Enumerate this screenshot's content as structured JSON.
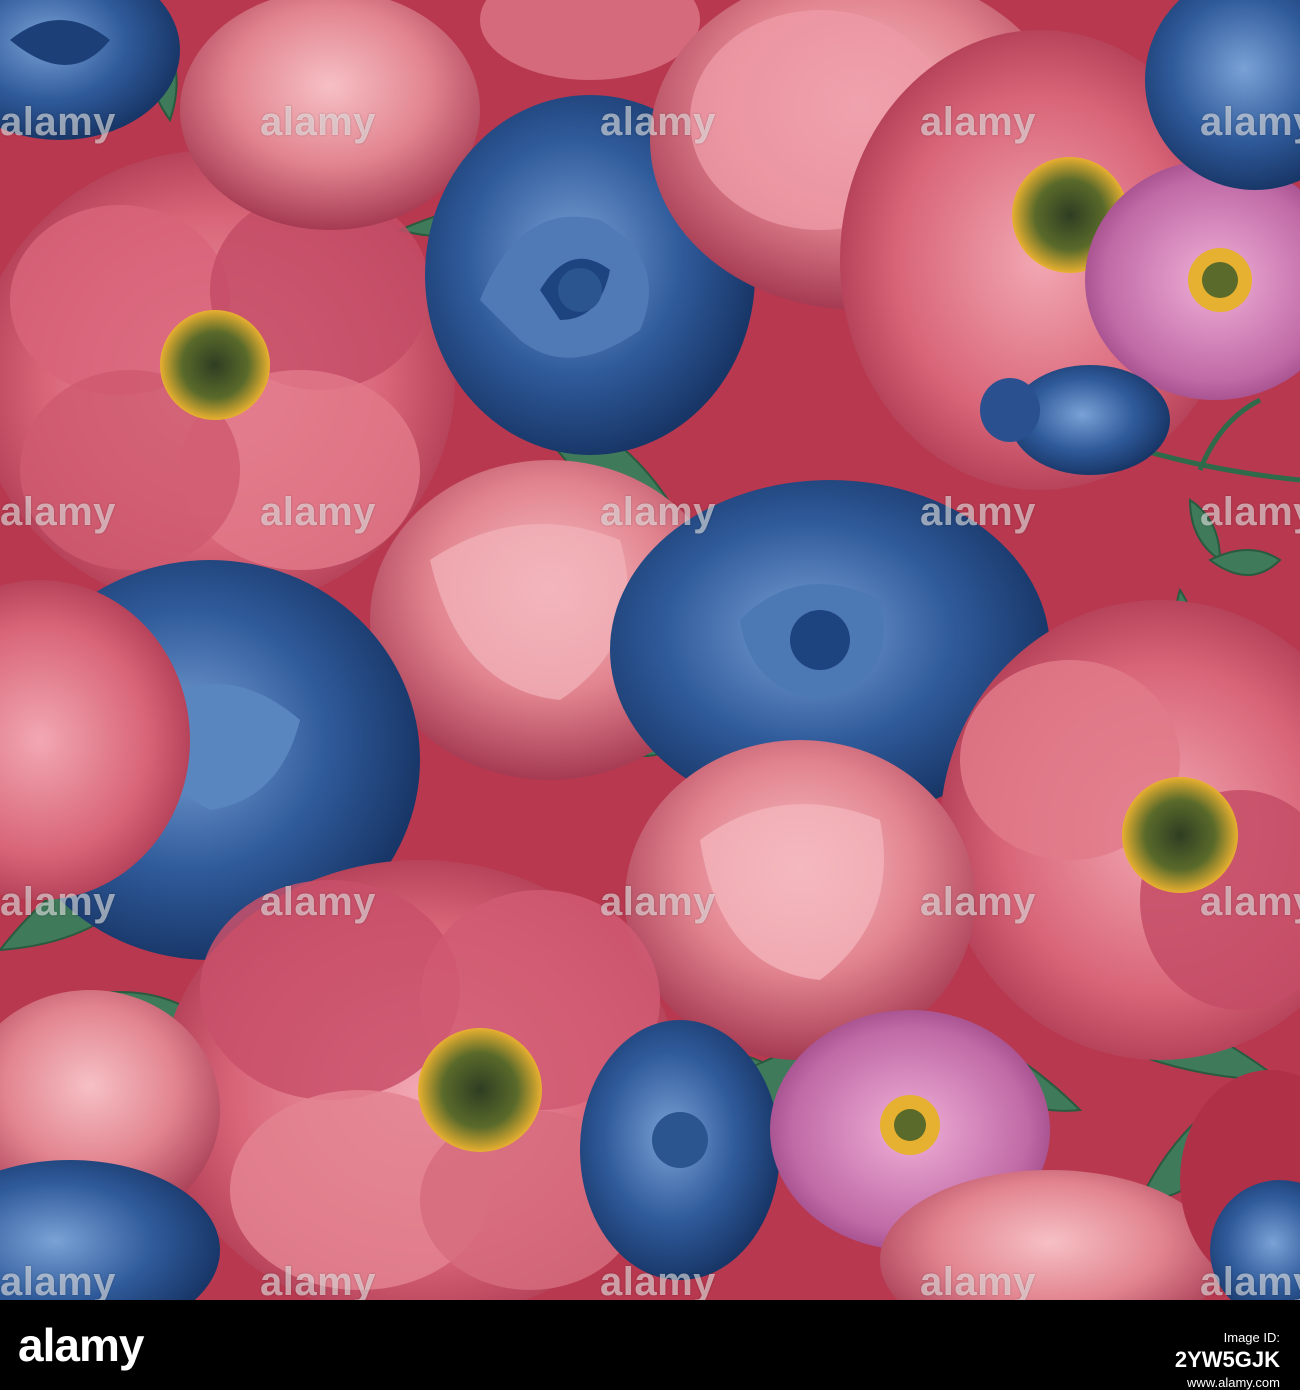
{
  "image": {
    "alt": "Seamless watercolor floral pattern of pink peonies, pink wild roses and blue roses",
    "colors": {
      "background": "#b8384f",
      "pink_petal": "#d9687a",
      "deep_pink": "#a8324a",
      "light_pink": "#f0a0a8",
      "blue_rose": "#2f5a9a",
      "deep_blue": "#1a3a72",
      "light_blue": "#6a94cc",
      "leaf": "#3f7a5a",
      "stamen": "#e8b030",
      "center": "#3a4a2a"
    }
  },
  "watermark": {
    "text": "alamy"
  },
  "footer": {
    "logo": "alamy",
    "image_id_label": "Image ID:",
    "image_id": "2YW5GJK",
    "url": "www.alamy.com"
  }
}
